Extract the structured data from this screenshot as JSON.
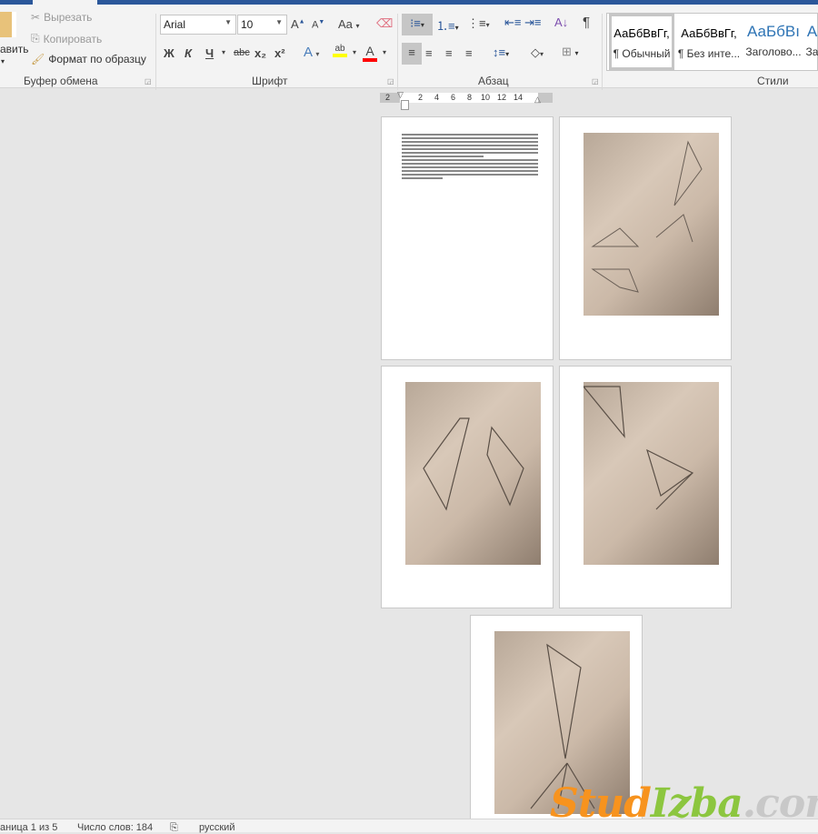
{
  "ribbon": {
    "clipboard": {
      "paste_label": "авить",
      "cut": "Вырезать",
      "copy": "Копировать",
      "format_painter": "Формат по образцу",
      "group": "Буфер обмена"
    },
    "font": {
      "name": "Arial",
      "size": "10",
      "bold": "Ж",
      "italic": "К",
      "underline": "Ч",
      "strike": "abc",
      "sub": "x₂",
      "sup": "x²",
      "case": "Aa",
      "group": "Шрифт",
      "highlight_color": "#ffff00",
      "font_color": "#ff0000"
    },
    "paragraph": {
      "group": "Абзац",
      "pilcrow": "¶"
    },
    "styles": {
      "group": "Стили",
      "items": [
        {
          "preview": "АаБбВвГг,",
          "name": "¶ Обычный"
        },
        {
          "preview": "АаБбВвГг,",
          "name": "¶ Без инте..."
        },
        {
          "preview": "АаБбВı",
          "name": "Заголово..."
        },
        {
          "preview": "А",
          "name": "За"
        }
      ]
    }
  },
  "ruler": {
    "indent": "2",
    "ticks": [
      "2",
      "4",
      "6",
      "8",
      "10",
      "12",
      "14"
    ]
  },
  "status": {
    "page": "аница 1 из 5",
    "words": "Число слов: 184",
    "language": "русский"
  },
  "watermark": {
    "part1": "Stud",
    "part2": "Izba",
    ".com": ".com",
    "text": "StudIzba.com"
  }
}
